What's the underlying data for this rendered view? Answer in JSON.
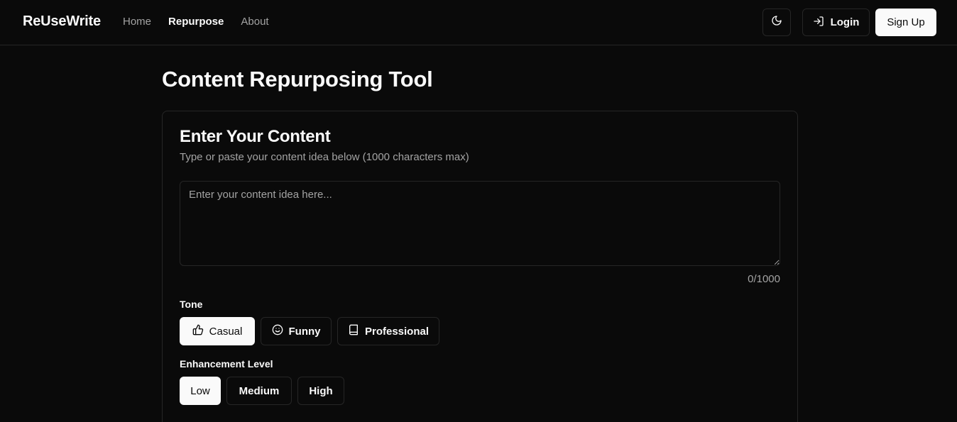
{
  "header": {
    "brand": "ReUseWrite",
    "nav": [
      {
        "label": "Home",
        "active": false
      },
      {
        "label": "Repurpose",
        "active": true
      },
      {
        "label": "About",
        "active": false
      }
    ],
    "theme_toggle_icon": "moon-icon",
    "login_label": "Login",
    "login_icon": "log-in-icon",
    "signup_label": "Sign Up"
  },
  "main": {
    "title": "Content Repurposing Tool",
    "card": {
      "title": "Enter Your Content",
      "description": "Type or paste your content idea below (1000 characters max)",
      "input": {
        "value": "",
        "placeholder": "Enter your content idea here..."
      },
      "char_count": "0/1000",
      "tone": {
        "label": "Tone",
        "options": [
          {
            "label": "Casual",
            "icon": "thumbs-up-icon",
            "selected": true
          },
          {
            "label": "Funny",
            "icon": "smile-icon",
            "selected": false
          },
          {
            "label": "Professional",
            "icon": "book-icon",
            "selected": false
          }
        ]
      },
      "enhancement": {
        "label": "Enhancement Level",
        "options": [
          {
            "label": "Low",
            "selected": true
          },
          {
            "label": "Medium",
            "selected": false
          },
          {
            "label": "High",
            "selected": false
          }
        ]
      }
    }
  },
  "colors": {
    "background": "#0a0a0a",
    "border": "#262626",
    "foreground": "#fafafa",
    "muted": "#a3a3a3"
  }
}
